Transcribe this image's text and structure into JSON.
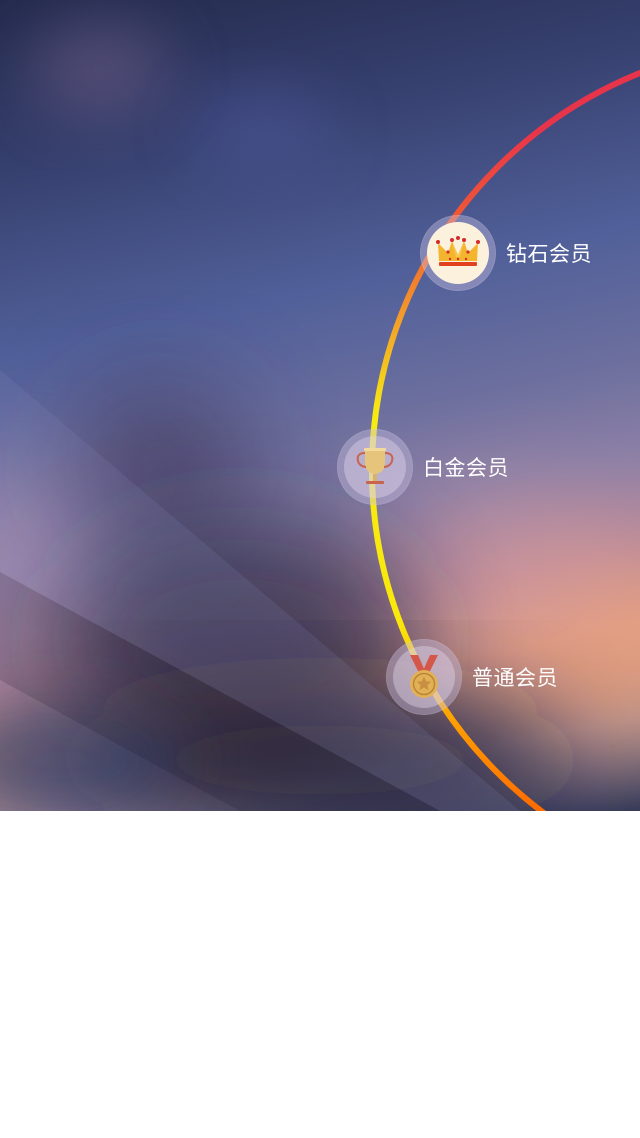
{
  "membership": {
    "tiers": [
      {
        "label": "钻石会员",
        "icon": "crown-icon",
        "active": true
      },
      {
        "label": "白金会员",
        "icon": "trophy-icon",
        "active": false
      },
      {
        "label": "普通会员",
        "icon": "medal-icon",
        "active": false
      }
    ]
  },
  "colors": {
    "ring_top": "#e8344a",
    "ring_upper": "#f39a2b",
    "ring_middle": "#f6ec12",
    "ring_bottom": "#ff6a00",
    "badge_active_bg": "#fbf1dd",
    "page_background": "#ffffff"
  }
}
